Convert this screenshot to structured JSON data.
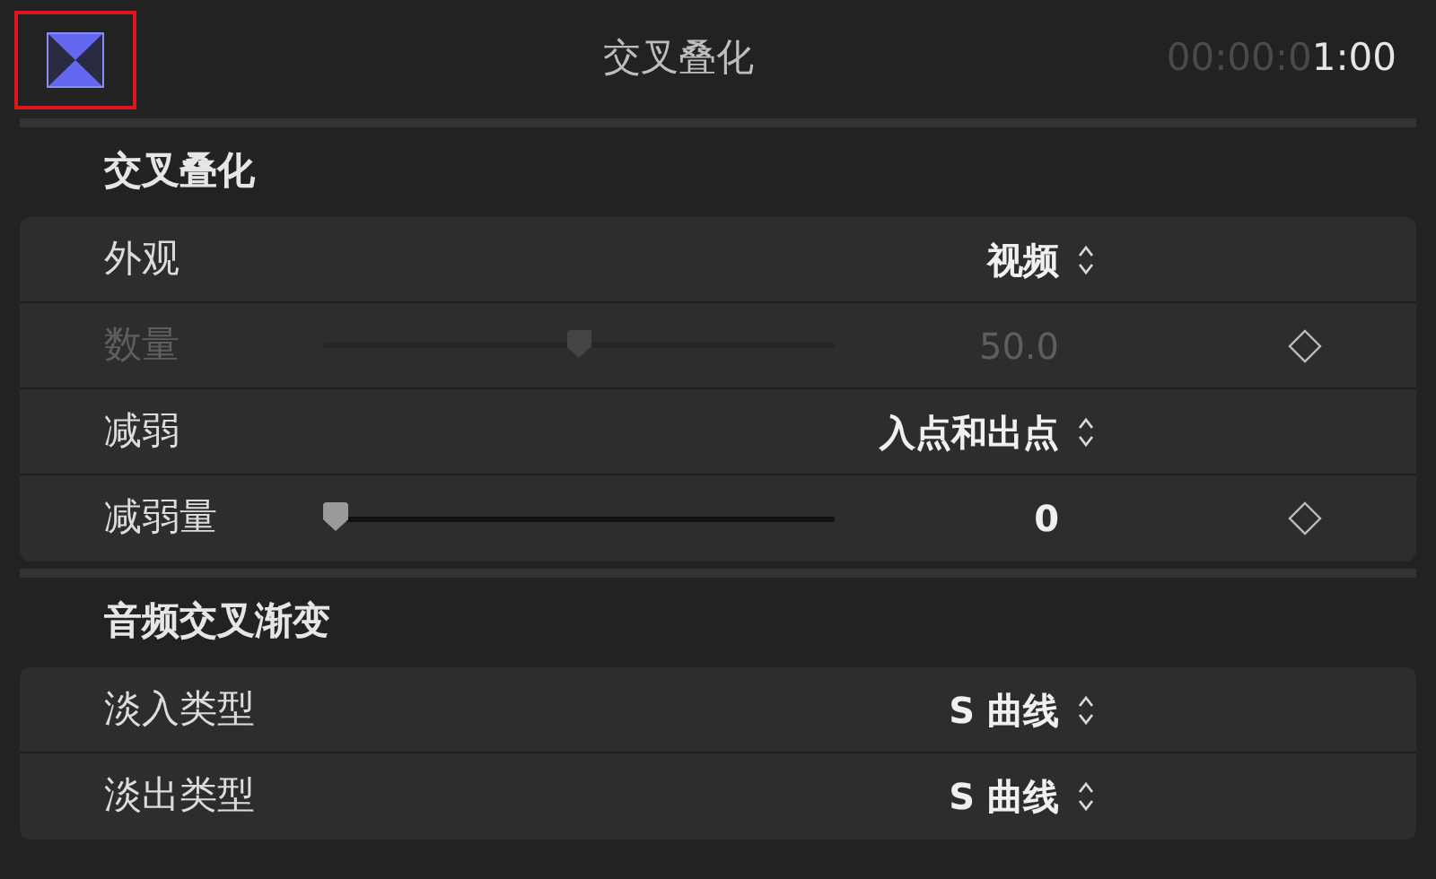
{
  "header": {
    "icon_highlighted": true,
    "title": "交叉叠化",
    "timecode_dim": "00:00:0",
    "timecode_bright": "1:00"
  },
  "sections": [
    {
      "title": "交叉叠化",
      "rows": [
        {
          "kind": "popup",
          "label": "外观",
          "value": "视频",
          "disabled": false
        },
        {
          "kind": "slider",
          "label": "数量",
          "level": 0.5,
          "value": "50.0",
          "disabled": true
        },
        {
          "kind": "popup",
          "label": "减弱",
          "value": "入点和出点",
          "disabled": false
        },
        {
          "kind": "slider",
          "label": "减弱量",
          "level": 0,
          "value": "0",
          "disabled": false
        }
      ]
    },
    {
      "title": "音频交叉渐变",
      "rows": [
        {
          "kind": "popup",
          "label": "淡入类型",
          "value": "S 曲线",
          "disabled": false
        },
        {
          "kind": "popup",
          "label": "淡出类型",
          "value": "S 曲线",
          "disabled": false
        }
      ]
    }
  ]
}
